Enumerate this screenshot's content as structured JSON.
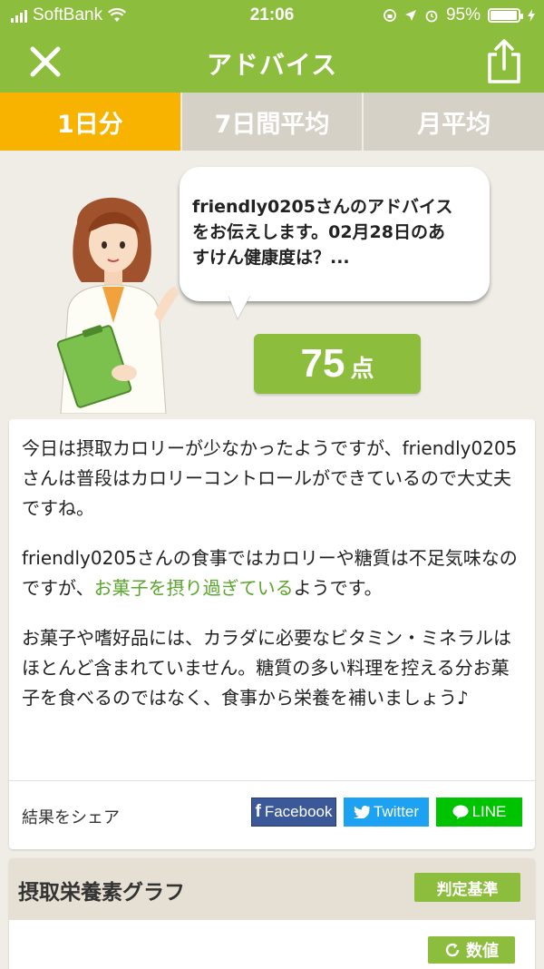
{
  "status_bar": {
    "carrier": "SoftBank",
    "time": "21:06",
    "battery": "95%",
    "battery_level": 0.95
  },
  "nav": {
    "title": "アドバイス",
    "close_icon": "close-icon",
    "share_icon": "share-icon"
  },
  "tabs": [
    {
      "label": "1日分",
      "active": true
    },
    {
      "label": "7日間平均",
      "active": false
    },
    {
      "label": "月平均",
      "active": false
    }
  ],
  "hero": {
    "bubble_line1": "friendly0205さんのアドバイス",
    "bubble_line2": "をお伝えします。02月28日のあ",
    "bubble_line3": "すけん健康度は？...",
    "score": "75",
    "score_unit": "点"
  },
  "advice": {
    "p1": "今日は摂取カロリーが少なかったようですが、friendly0205さんは普段はカロリーコントロールができているので大丈夫ですね。",
    "p2_before": "friendly0205さんの食事ではカロリーや糖質は不足気味なのですが、",
    "p2_highlight": "お菓子を摂り過ぎている",
    "p2_after": "ようです。",
    "p3": "お菓子や嗜好品には、カラダに必要なビタミン・ミネラルはほとんど含まれていません。糖質の多い料理を控える分お菓子を食べるのではなく、食事から栄養を補いましょう♪",
    "share_label": "結果をシェア",
    "facebook": "Facebook",
    "twitter": "Twitter",
    "line": "LINE"
  },
  "graph": {
    "title": "摂取栄養素グラフ",
    "criteria_button": "判定基準",
    "value_button": "数値"
  },
  "colors": {
    "brand_green": "#8cbd3c",
    "tab_active": "#f7b300",
    "highlight": "#5aa52b"
  }
}
